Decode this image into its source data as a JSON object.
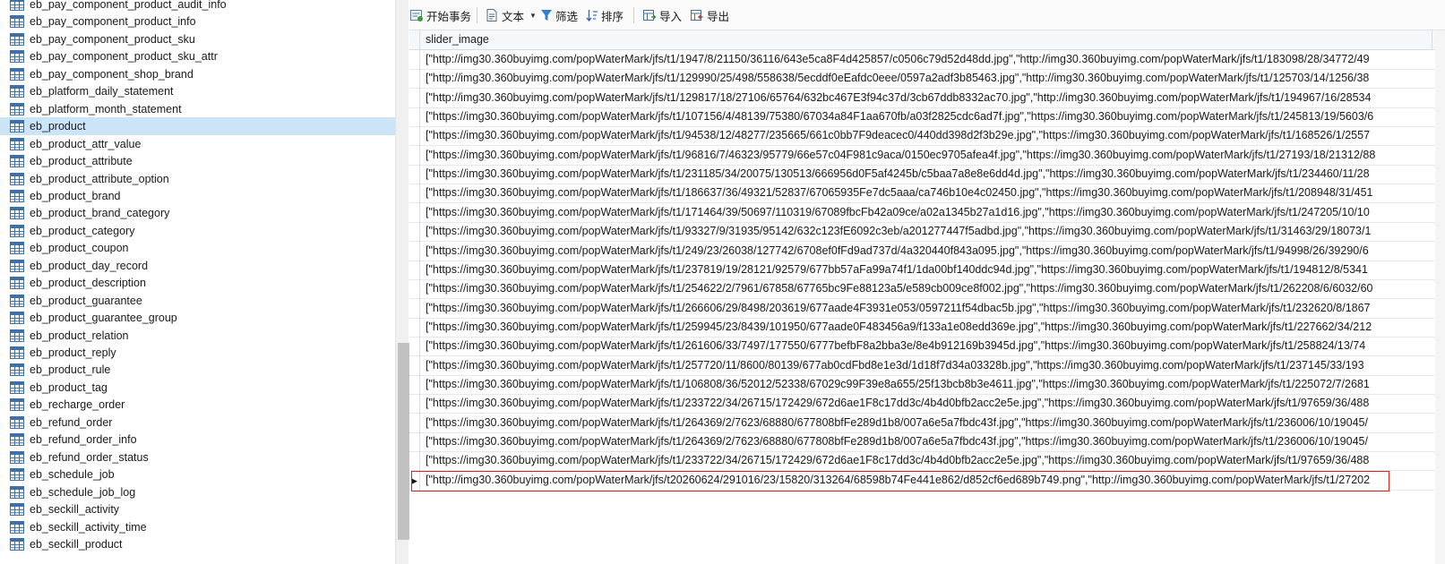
{
  "sidebar": {
    "items": [
      "eb_pay_component_product_audit_info",
      "eb_pay_component_product_info",
      "eb_pay_component_product_sku",
      "eb_pay_component_product_sku_attr",
      "eb_pay_component_shop_brand",
      "eb_platform_daily_statement",
      "eb_platform_month_statement",
      "eb_product",
      "eb_product_attr_value",
      "eb_product_attribute",
      "eb_product_attribute_option",
      "eb_product_brand",
      "eb_product_brand_category",
      "eb_product_category",
      "eb_product_coupon",
      "eb_product_day_record",
      "eb_product_description",
      "eb_product_guarantee",
      "eb_product_guarantee_group",
      "eb_product_relation",
      "eb_product_reply",
      "eb_product_rule",
      "eb_product_tag",
      "eb_recharge_order",
      "eb_refund_order",
      "eb_refund_order_info",
      "eb_refund_order_status",
      "eb_schedule_job",
      "eb_schedule_job_log",
      "eb_seckill_activity",
      "eb_seckill_activity_time",
      "eb_seckill_product"
    ],
    "selected": "eb_product"
  },
  "toolbar": {
    "begin_transaction": "开始事务",
    "text": "文本",
    "filter": "筛选",
    "sort": "排序",
    "import": "导入",
    "export": "导出"
  },
  "grid": {
    "column": "slider_image",
    "current_row_marker": "▶",
    "rows": [
      "[\"http://img30.360buyimg.com/popWaterMark/jfs/t1/1947/8/21150/36116/643e5ca8F4d425857/c0506c79d52d48dd.jpg\",\"http://img30.360buyimg.com/popWaterMark/jfs/t1/183098/28/34772/49",
      "[\"http://img30.360buyimg.com/popWaterMark/jfs/t1/129990/25/498/558638/5ecddf0eEafdc0eee/0597a2adf3b85463.jpg\",\"http://img30.360buyimg.com/popWaterMark/jfs/t1/125703/14/1256/38",
      "[\"http://img30.360buyimg.com/popWaterMark/jfs/t1/129817/18/27106/65764/632bc467E3f94c37d/3cb67ddb8332ac70.jpg\",\"http://img30.360buyimg.com/popWaterMark/jfs/t1/194967/16/28534",
      "[\"https://img30.360buyimg.com/popWaterMark/jfs/t1/107156/4/48139/75380/67034a84F1aa670fb/a03f2825cdc6ad7f.jpg\",\"https://img30.360buyimg.com/popWaterMark/jfs/t1/245813/19/5603/6",
      "[\"https://img30.360buyimg.com/popWaterMark/jfs/t1/94538/12/48277/235665/661c0bb7F9deacec0/440dd398d2f3b29e.jpg\",\"https://img30.360buyimg.com/popWaterMark/jfs/t1/168526/1/2557",
      "[\"https://img30.360buyimg.com/popWaterMark/jfs/t1/96816/7/46323/95779/66e57c04F981c9aca/0150ec9705afea4f.jpg\",\"https://img30.360buyimg.com/popWaterMark/jfs/t1/27193/18/21312/88",
      "[\"https://img30.360buyimg.com/popWaterMark/jfs/t1/231185/34/20075/130513/666956d0F5af4245b/c5baa7a8e8e6dd4d.jpg\",\"https://img30.360buyimg.com/popWaterMark/jfs/t1/234460/11/28",
      "[\"https://img30.360buyimg.com/popWaterMark/jfs/t1/186637/36/49321/52837/67065935Fe7dc5aaa/ca746b10e4c02450.jpg\",\"https://img30.360buyimg.com/popWaterMark/jfs/t1/208948/31/451",
      "[\"https://img30.360buyimg.com/popWaterMark/jfs/t1/171464/39/50697/110319/67089fbcFb42a09ce/a02a1345b27a1d16.jpg\",\"https://img30.360buyimg.com/popWaterMark/jfs/t1/247205/10/10",
      "[\"https://img30.360buyimg.com/popWaterMark/jfs/t1/93327/9/31935/95142/632c123fE6092c3eb/a201277447f5adbd.jpg\",\"https://img30.360buyimg.com/popWaterMark/jfs/t1/31463/29/18073/1",
      "[\"https://img30.360buyimg.com/popWaterMark/jfs/t1/249/23/26038/127742/6708ef0fFd9ad737d/4a320440f843a095.jpg\",\"https://img30.360buyimg.com/popWaterMark/jfs/t1/94998/26/39290/6",
      "[\"https://img30.360buyimg.com/popWaterMark/jfs/t1/237819/19/28121/92579/677bb57aFa99a74f1/1da00bf140ddc94d.jpg\",\"https://img30.360buyimg.com/popWaterMark/jfs/t1/194812/8/5341",
      "[\"https://img30.360buyimg.com/popWaterMark/jfs/t1/254622/2/7961/67858/67765bc9Fe88123a5/e589cb009ce8f002.jpg\",\"https://img30.360buyimg.com/popWaterMark/jfs/t1/262208/6/6032/60",
      "[\"https://img30.360buyimg.com/popWaterMark/jfs/t1/266606/29/8498/203619/677aade4F3931e053/0597211f54dbac5b.jpg\",\"https://img30.360buyimg.com/popWaterMark/jfs/t1/232620/8/1867",
      "[\"https://img30.360buyimg.com/popWaterMark/jfs/t1/259945/23/8439/101950/677aade0F483456a9/f133a1e08edd369e.jpg\",\"https://img30.360buyimg.com/popWaterMark/jfs/t1/227662/34/212",
      "[\"https://img30.360buyimg.com/popWaterMark/jfs/t1/261606/33/7497/177550/6777befbF8a2bba3e/8e4b912169b3945d.jpg\",\"https://img30.360buyimg.com/popWaterMark/jfs/t1/258824/13/74",
      "[\"https://img30.360buyimg.com/popWaterMark/jfs/t1/257720/11/8600/80139/677ab0cdFbd8e1e3d/1d18f7d34a03328b.jpg\",\"https://img30.360buyimg.com/popWaterMark/jfs/t1/237145/33/193",
      "[\"https://img30.360buyimg.com/popWaterMark/jfs/t1/106808/36/52012/52338/67029c99F39e8a655/25f13bcb8b3e4611.jpg\",\"https://img30.360buyimg.com/popWaterMark/jfs/t1/225072/7/2681",
      "[\"https://img30.360buyimg.com/popWaterMark/jfs/t1/233722/34/26715/172429/672d6ae1F8c17dd3c/4b4d0bfb2acc2e5e.jpg\",\"https://img30.360buyimg.com/popWaterMark/jfs/t1/97659/36/488",
      "[\"https://img30.360buyimg.com/popWaterMark/jfs/t1/264369/2/7623/68880/677808bfFe289d1b8/007a6e5a7fbdc43f.jpg\",\"https://img30.360buyimg.com/popWaterMark/jfs/t1/236006/10/19045/",
      "[\"https://img30.360buyimg.com/popWaterMark/jfs/t1/264369/2/7623/68880/677808bfFe289d1b8/007a6e5a7fbdc43f.jpg\",\"https://img30.360buyimg.com/popWaterMark/jfs/t1/236006/10/19045/",
      "[\"https://img30.360buyimg.com/popWaterMark/jfs/t1/233722/34/26715/172429/672d6ae1F8c17dd3c/4b4d0bfb2acc2e5e.jpg\",\"https://img30.360buyimg.com/popWaterMark/jfs/t1/97659/36/488",
      "[\"http://img30.360buyimg.com/popWaterMark/jfs/t20260624/291016/23/15820/313264/68598b74Fe441e862/d852cf6ed689b749.png\",\"http://img30.360buyimg.com/popWaterMark/jfs/t1/27202"
    ]
  },
  "colors": {
    "selection": "#cce4f7",
    "highlight_border": "#e0201a",
    "toolbar_bg": "#fafafa"
  }
}
